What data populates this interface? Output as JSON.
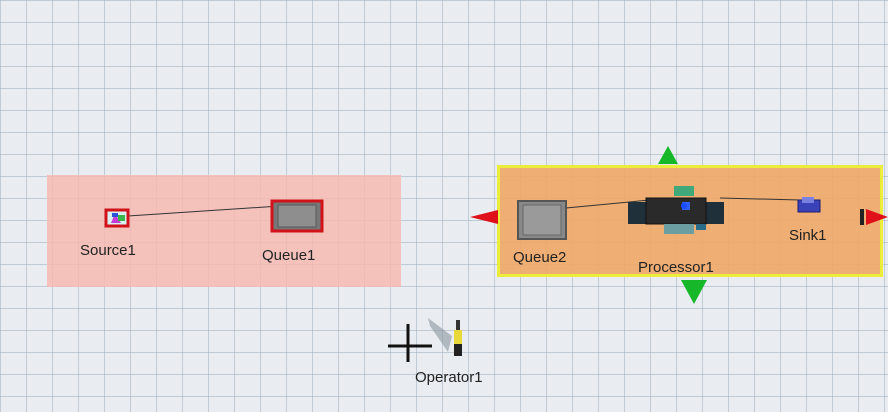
{
  "model": {
    "objects": [
      {
        "id": "source",
        "label": "Source1",
        "type": "source-icon"
      },
      {
        "id": "queue1",
        "label": "Queue1",
        "type": "queue-icon"
      },
      {
        "id": "queue2",
        "label": "Queue2",
        "type": "queue-icon"
      },
      {
        "id": "processor",
        "label": "Processor1",
        "type": "conveyor-icon"
      },
      {
        "id": "sink",
        "label": "Sink1",
        "type": "sink-icon"
      },
      {
        "id": "operator",
        "label": "Operator1",
        "type": "operator-icon"
      }
    ],
    "colors": {
      "floor": "#e9edf1",
      "grid": "#a0afbe",
      "plane_left": "#f6bab2",
      "plane_right": "#efa868",
      "selection_border": "#ecec3a",
      "handle_red": "#e0101a",
      "handle_green": "#16b82a"
    }
  }
}
